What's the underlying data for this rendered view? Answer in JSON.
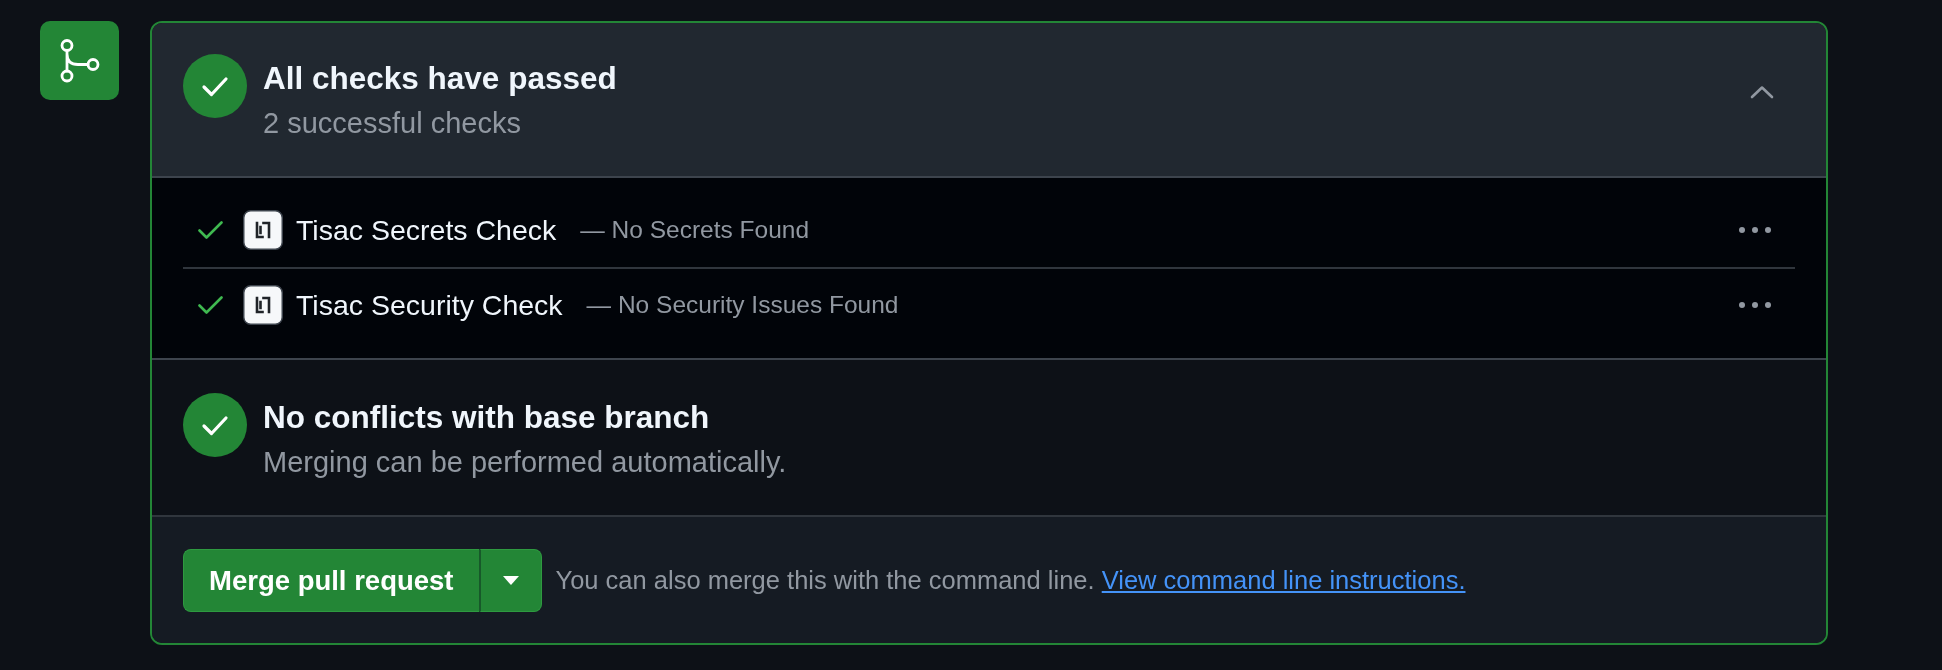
{
  "merge_box": {
    "header": {
      "passed": true,
      "title": "All checks have passed",
      "subtitle": "2 successful checks",
      "expanded": true
    },
    "checks": [
      {
        "passed": true,
        "name": "Tisac Secrets Check",
        "description": "— No Secrets Found"
      },
      {
        "passed": true,
        "name": "Tisac Security Check",
        "description": "— No Security Issues Found"
      }
    ],
    "conflicts": {
      "passed": true,
      "title": "No conflicts with base branch",
      "subtitle": "Merging can be performed automatically."
    },
    "merge": {
      "button": "Merge pull request",
      "hint": "You can also merge this with the command line.",
      "link": "View command line instructions."
    }
  }
}
